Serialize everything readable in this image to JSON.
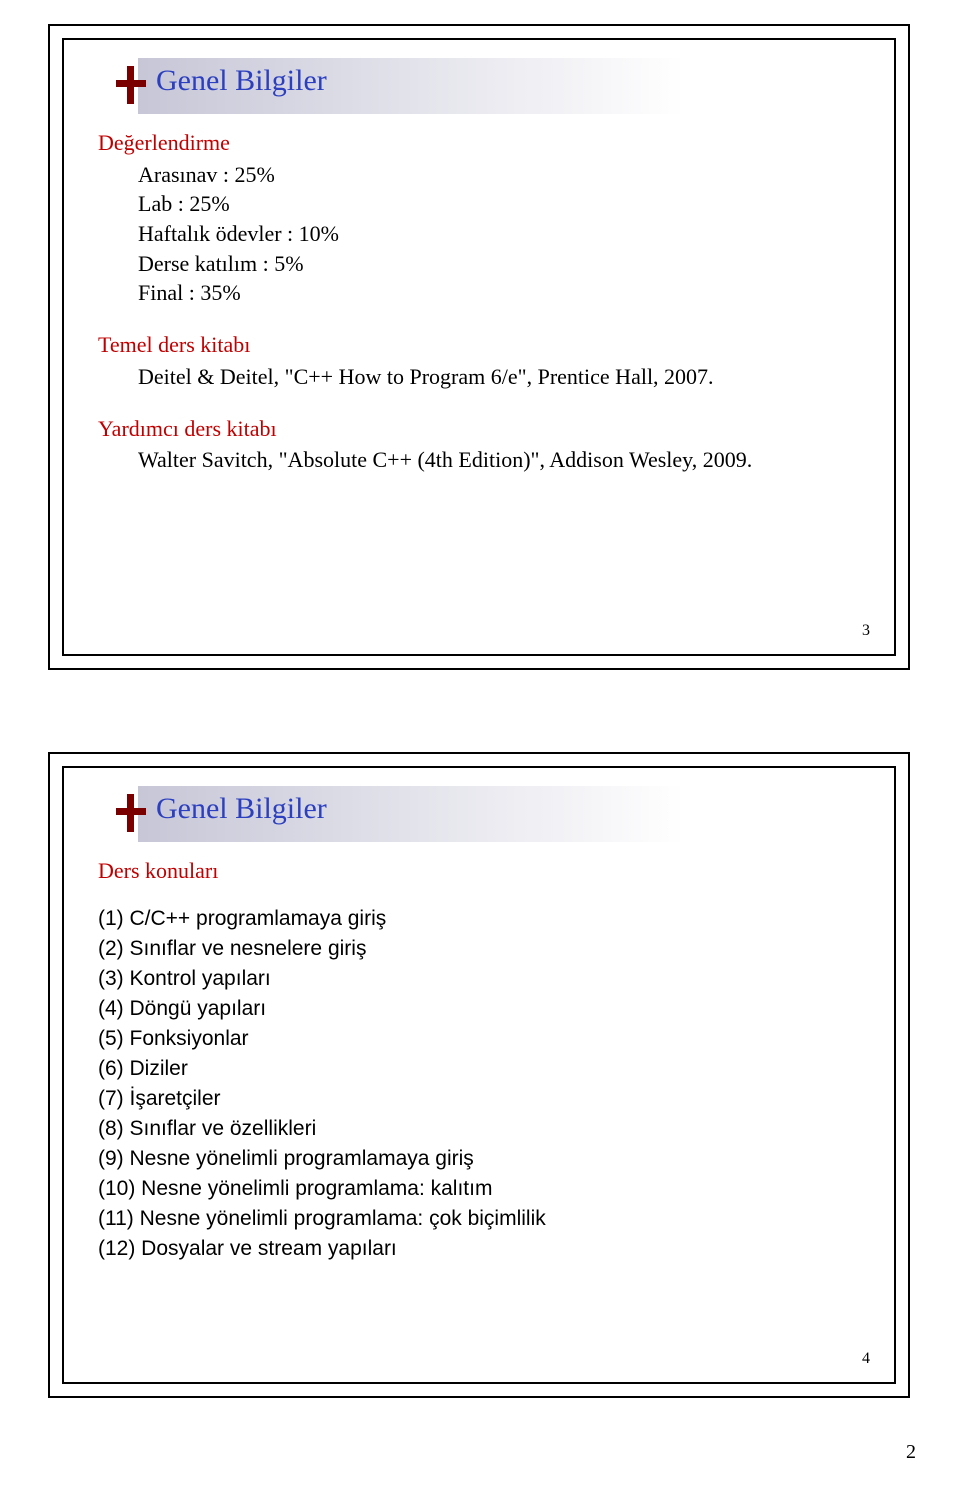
{
  "slide1": {
    "title": "Genel Bilgiler",
    "eval_heading": "Değerlendirme",
    "eval": {
      "arasinav": "Arasınav : 25%",
      "lab": "Lab : 25%",
      "haftalik": "Haftalık ödevler : 10%",
      "katilim": "Derse katılım : 5%",
      "final": "Final : 35%"
    },
    "main_book_heading": "Temel ders kitabı",
    "main_book": "Deitel & Deitel, \"C++ How to Program 6/e\", Prentice  Hall, 2007.",
    "aux_book_heading": "Yardımcı ders kitabı",
    "aux_book": "Walter Savitch, \"Absolute C++ (4th Edition)\", Addison Wesley, 2009.",
    "page_num": "3"
  },
  "slide2": {
    "title": "Genel Bilgiler",
    "topics_heading": "Ders konuları",
    "topics": [
      "(1) C/C++ programlamaya giriş",
      "(2) Sınıflar ve nesnelere giriş",
      "(3) Kontrol yapıları",
      "(4) Döngü yapıları",
      "(5) Fonksiyonlar",
      "(6) Diziler",
      "(7) İşaretçiler",
      "(8) Sınıflar ve özellikleri",
      "(9) Nesne yönelimli programlamaya giriş",
      "(10) Nesne yönelimli programlama: kalıtım",
      "(11) Nesne yönelimli programlama: çok biçimlilik",
      "(12) Dosyalar ve stream yapıları"
    ],
    "page_num": "4"
  },
  "page_number": "2"
}
